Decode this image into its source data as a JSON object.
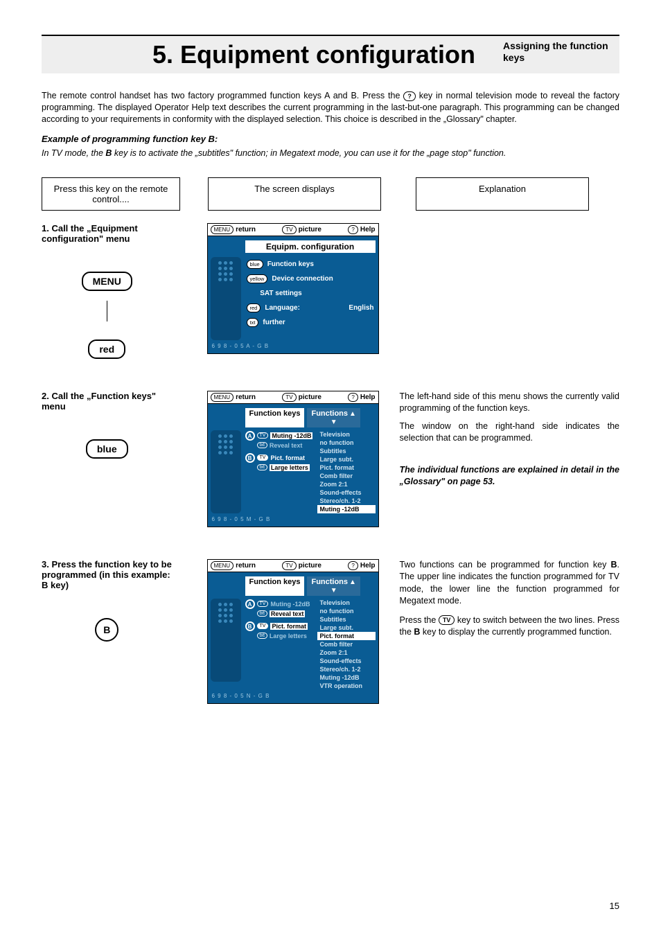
{
  "header": {
    "title": "5. Equipment configuration",
    "subtitle": "Assigning the function keys"
  },
  "intro": "The remote control handset has two factory programmed function keys A and B. Press the ? key in normal television mode to reveal the factory programming. The displayed Operator Help text describes the current programming in the last-but-one paragraph. This programming can be changed according to your requirements in conformity with the displayed selection. This choice is described in the „Glossary\" chapter.",
  "example_header": "Example of programming function key B:",
  "example_line_pre": "In TV mode, the ",
  "example_line_mid": " key is to activate the „subtitles\" function; in Megatext mode, you can use it for the „page stop\" function.",
  "example_key": "B",
  "col_headers": {
    "left": "Press this key on the remote control....",
    "mid": "The screen displays",
    "right": "Explanation"
  },
  "screen_header": {
    "menu_pill": "MENU",
    "return": "return",
    "tv_pill": "TV",
    "picture": "picture",
    "help_pill": "?",
    "help": "Help"
  },
  "step1": {
    "label": "1. Call the „Equipment configuration\" menu",
    "keys": [
      "MENU",
      "red"
    ],
    "screen_title": "Equipm. configuration",
    "menu_items": [
      {
        "pill": "blue",
        "label": "Function keys"
      },
      {
        "pill": "yellow",
        "label": "Device connection"
      },
      {
        "pill": "",
        "label": "SAT settings"
      },
      {
        "pill": "red",
        "label": "Language:",
        "value": "English"
      },
      {
        "pill": "txt",
        "label": "further"
      }
    ],
    "code": "6 9 8 - 0 5 A - G B"
  },
  "step2": {
    "label": "2. Call the „Function keys\" menu",
    "keys": [
      "blue"
    ],
    "panel_left": "Function keys",
    "panel_right": "Functions",
    "A_rows": [
      {
        "pill": "TV",
        "label": "Muting -12dB",
        "hi": true
      },
      {
        "pill": "txt",
        "label": "Reveal text"
      }
    ],
    "B_rows": [
      {
        "pill": "TV",
        "label": "Pict. format",
        "pillwhite": true
      },
      {
        "pill": "txt",
        "label": "Large letters",
        "labelwhite": true
      }
    ],
    "func_list": [
      "Television",
      "no function",
      "Subtitles",
      "Large subt.",
      "Pict. format",
      "Comb filter",
      "Zoom 2:1",
      "Sound-effects",
      "Stereo/ch. 1-2",
      "Muting -12dB"
    ],
    "func_hi_index": 9,
    "code": "6 9 8 - 0 5 M - G B",
    "explanation": {
      "p1": "The left-hand side of this menu shows the currently valid programming of the function keys.",
      "p2": "The window on the right-hand side indicates the selection that can be programmed.",
      "p3": "The individual functions are explained in detail in the „Glossary\" on page 53."
    }
  },
  "step3": {
    "label": "3. Press the function key to be programmed (in this example: B key)",
    "key": "B",
    "panel_left": "Function keys",
    "panel_right": "Functions",
    "A_rows": [
      {
        "pill": "TV",
        "label": "Muting -12dB"
      },
      {
        "pill": "txt",
        "label": "Reveal text",
        "labelwhite": true
      }
    ],
    "B_rows": [
      {
        "pill": "TV",
        "label": "Pict. format",
        "pillwhite": true,
        "labelwhite": true
      },
      {
        "pill": "txt",
        "label": "Large letters"
      }
    ],
    "func_list": [
      "Television",
      "no function",
      "Subtitles",
      "Large subt.",
      "Pict. format",
      "Comb filter",
      "Zoom 2:1",
      "Sound-effects",
      "Stereo/ch. 1-2",
      "Muting -12dB",
      "VTR operation"
    ],
    "func_hi_index": 4,
    "code": "6 9 8 - 0 5 N - G B",
    "explanation": {
      "p1_pre": "Two functions can be programmed for function key ",
      "p1_key": "B",
      "p1_post": ". The upper line indicates the function programmed for TV mode, the lower line the function programmed for Megatext mode.",
      "p2_pre": "Press the ",
      "p2_key": "TV",
      "p2_mid": " key to switch between the two lines. Press the ",
      "p2_key2": "B",
      "p2_post": " key to display the currently programmed function."
    }
  },
  "pagenum": "15"
}
